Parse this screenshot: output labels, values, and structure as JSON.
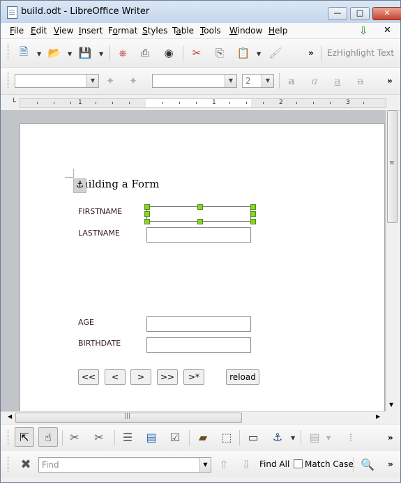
{
  "window": {
    "title": "build.odt - LibreOffice Writer",
    "minimize": "—",
    "maximize": "□",
    "close": "✕"
  },
  "menubar": {
    "items": [
      {
        "pre": "",
        "key": "F",
        "post": "ile"
      },
      {
        "pre": "",
        "key": "E",
        "post": "dit"
      },
      {
        "pre": "",
        "key": "V",
        "post": "iew"
      },
      {
        "pre": "",
        "key": "I",
        "post": "nsert"
      },
      {
        "pre": "F",
        "key": "o",
        "post": "rmat"
      },
      {
        "pre": "",
        "key": "S",
        "post": "tyles"
      },
      {
        "pre": "T",
        "key": "a",
        "post": "ble"
      },
      {
        "pre": "",
        "key": "T",
        "post": "ools"
      },
      {
        "pre": "",
        "key": "W",
        "post": "indow"
      },
      {
        "pre": "",
        "key": "H",
        "post": "elp"
      }
    ],
    "doc_close": "✕"
  },
  "standard_toolbar": {
    "ezhighlight_label": "EzHighlight Text",
    "overflow": "»"
  },
  "formatting_toolbar": {
    "font_size": "2",
    "overflow": "»"
  },
  "ruler": {
    "labels": [
      "1",
      "1",
      "2",
      "3"
    ]
  },
  "document": {
    "heading": "Building a Form",
    "fields": [
      {
        "label": "FIRSTNAME",
        "value": ""
      },
      {
        "label": "LASTNAME",
        "value": ""
      },
      {
        "label": "AGE",
        "value": ""
      },
      {
        "label": "BIRTHDATE",
        "value": ""
      }
    ],
    "nav_buttons": [
      "<<",
      "<",
      ">",
      ">>",
      ">*"
    ],
    "reload_button": "reload"
  },
  "scroll": {
    "h_grip": "|||",
    "v_grip": "≡"
  },
  "form_controls_toolbar": {
    "overflow": "»"
  },
  "find_toolbar": {
    "placeholder": "Find",
    "find_all": "Find All",
    "match_case": "Match Case",
    "overflow": "»"
  }
}
